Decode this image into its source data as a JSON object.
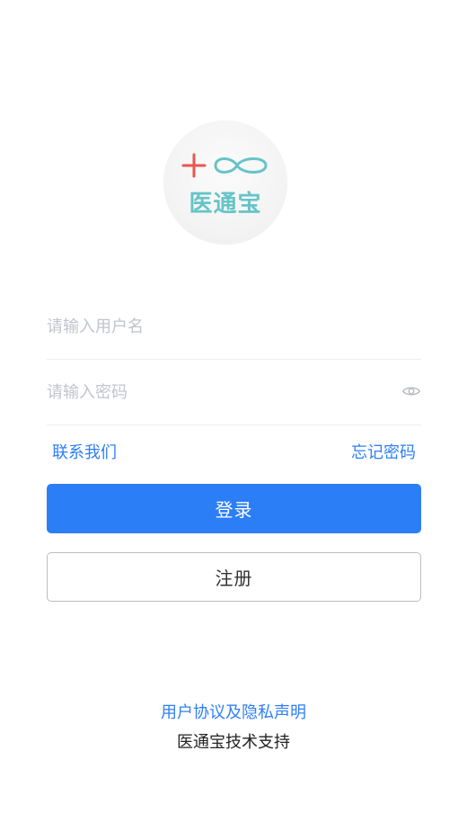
{
  "app": {
    "logo_text": "医通宝"
  },
  "form": {
    "username_placeholder": "请输入用户名",
    "password_placeholder": "请输入密码",
    "username_value": "",
    "password_value": ""
  },
  "links": {
    "contact": "联系我们",
    "forgot": "忘记密码"
  },
  "buttons": {
    "login": "登录",
    "register": "注册"
  },
  "footer": {
    "agreement": "用户协议及隐私声明",
    "support": "医通宝技术支持"
  },
  "colors": {
    "primary": "#2c7ef7",
    "link": "#2f7ff6",
    "logo_teal": "#66c4c7",
    "logo_red": "#e8574f"
  },
  "icons": {
    "password_toggle": "eye-icon"
  }
}
